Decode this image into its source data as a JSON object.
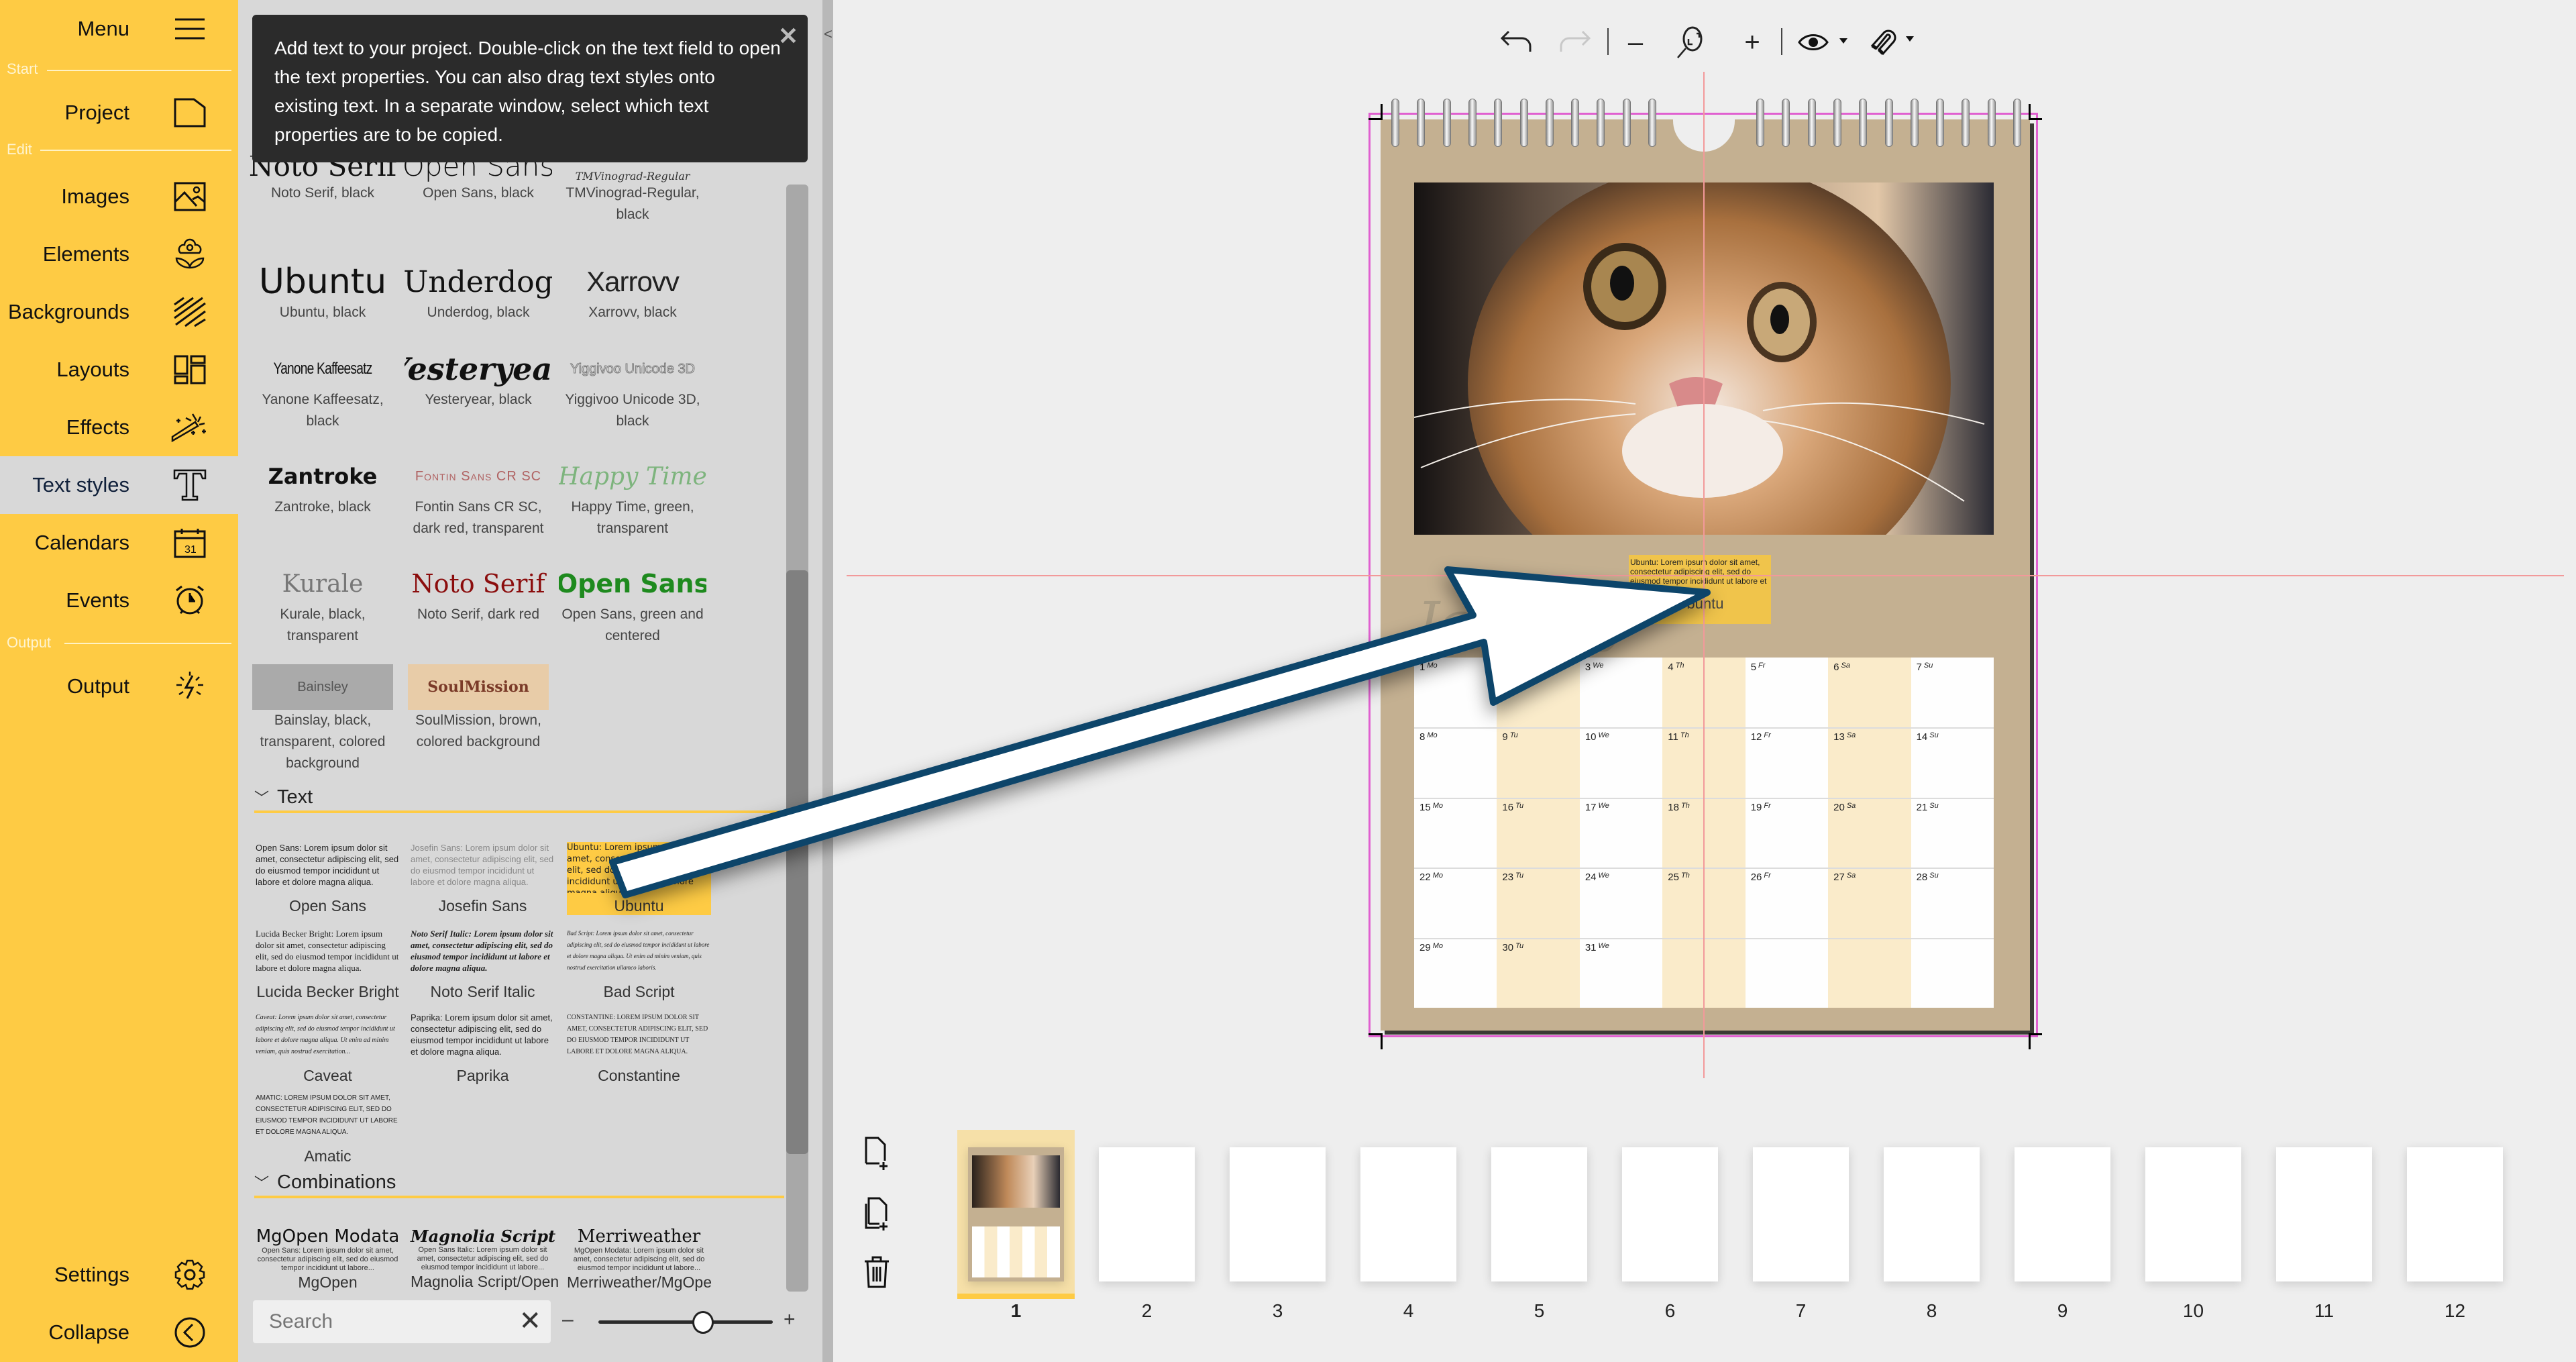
{
  "sidebar": {
    "menu_label": "Menu",
    "sections": {
      "start": "Start",
      "edit": "Edit",
      "output": "Output"
    },
    "items": [
      {
        "label": "Project",
        "icon": "page-icon"
      },
      {
        "label": "Images",
        "icon": "image-icon"
      },
      {
        "label": "Elements",
        "icon": "flower-icon"
      },
      {
        "label": "Backgrounds",
        "icon": "hatch-icon"
      },
      {
        "label": "Layouts",
        "icon": "layout-icon"
      },
      {
        "label": "Effects",
        "icon": "magic-wand-icon"
      },
      {
        "label": "Text styles",
        "icon": "text-icon",
        "active": true
      },
      {
        "label": "Calendars",
        "icon": "calendar-icon"
      },
      {
        "label": "Events",
        "icon": "alarm-clock-icon"
      },
      {
        "label": "Output",
        "icon": "output-icon"
      }
    ],
    "settings_label": "Settings",
    "collapse_label": "Collapse"
  },
  "panel": {
    "tooltip": "Add text to your project. Double-click on the text field to open the text properties. You can also drag text styles onto existing text. In a separate window, select which text properties are to be copied.",
    "tooltip_close": "✕",
    "styles": [
      {
        "sample": "Noto Serif",
        "desc": "Noto Serif, black"
      },
      {
        "sample": "Open Sans",
        "desc": "Open Sans, black"
      },
      {
        "sample": "TMVinograd-Regular",
        "desc": "TMVinograd-Regular, black"
      },
      {
        "sample": "Ubuntu",
        "desc": "Ubuntu, black"
      },
      {
        "sample": "Underdog",
        "desc": "Underdog, black"
      },
      {
        "sample": "Xarrovv",
        "desc": "Xarrovv, black"
      },
      {
        "sample": "Yanone Kaffeesatz",
        "desc": "Yanone Kaffeesatz, black"
      },
      {
        "sample": "Yesteryear",
        "desc": "Yesteryear, black"
      },
      {
        "sample": "Yiggivoo Unicode 3D",
        "desc": "Yiggivoo Unicode 3D, black"
      },
      {
        "sample": "Zantroke",
        "desc": "Zantroke, black"
      },
      {
        "sample": "Fontin Sans CR SC",
        "desc": "Fontin Sans CR SC, dark red, transparent"
      },
      {
        "sample": "Happy Time",
        "desc": "Happy Time, green, transparent"
      },
      {
        "sample": "Kurale",
        "desc": "Kurale, black, transparent"
      },
      {
        "sample": "Noto Serif",
        "desc": "Noto Serif, dark red"
      },
      {
        "sample": "Open Sans",
        "desc": "Open Sans, green and centered"
      },
      {
        "sample": "Bainsley",
        "desc": "Bainslay, black, transparent, colored background"
      },
      {
        "sample": "SoulMission",
        "desc": "SoulMission, brown, colored background"
      }
    ],
    "text_section": "Text",
    "text_items": [
      {
        "lorem": "Open Sans: Lorem ipsum dolor sit amet, consectetur adipiscing elit, sed do eiusmod tempor incididunt ut labore et dolore magna aliqua.",
        "name": "Open Sans"
      },
      {
        "lorem": "Josefin Sans: Lorem ipsum dolor sit amet, consectetur adipiscing elit, sed do eiusmod tempor incididunt ut labore et dolore magna aliqua.",
        "name": "Josefin Sans"
      },
      {
        "lorem": "Ubuntu: Lorem ipsum dolor sit amet, consectetur adipiscing elit, sed do eiusmod tempor incididunt ut labore et dolore magna aliqua.",
        "name": "Ubuntu",
        "selected": true
      },
      {
        "lorem": "Lucida Becker Bright: Lorem ipsum dolor sit amet, consectetur adipiscing elit, sed do eiusmod tempor incididunt ut labore et dolore magna aliqua.",
        "name": "Lucida Becker Bright"
      },
      {
        "lorem": "Noto Serif Italic: Lorem ipsum dolor sit amet, consectetur adipiscing elit, sed do eiusmod tempor incididunt ut labore et dolore magna aliqua.",
        "name": "Noto Serif Italic"
      },
      {
        "lorem": "Bad Script: Lorem ipsum dolor sit amet, consectetur adipiscing elit, sed do eiusmod tempor incididunt ut labore et dolore magna aliqua. Ut enim ad minim veniam, quis nostrud exercitation ullamco laboris.",
        "name": "Bad Script"
      },
      {
        "lorem": "Caveat: Lorem ipsum dolor sit amet, consectetur adipiscing elit, sed do eiusmod tempor incididunt ut labore et dolore magna aliqua. Ut enim ad minim veniam, quis nostrud exercitation...",
        "name": "Caveat"
      },
      {
        "lorem": "Paprika: Lorem ipsum dolor sit amet, consectetur adipiscing elit, sed do eiusmod tempor incididunt ut labore et dolore magna aliqua.",
        "name": "Paprika"
      },
      {
        "lorem": "CONSTANTINE: LOREM IPSUM DOLOR SIT AMET, CONSECTETUR ADIPISCING ELIT, SED DO EIUSMOD TEMPOR INCIDIDUNT UT LABORE ET DOLORE MAGNA ALIQUA.",
        "name": "Constantine"
      },
      {
        "lorem": "AMATIC: LOREM IPSUM DOLOR SIT AMET, CONSECTETUR ADIPISCING ELIT, SED DO EIUSMOD TEMPOR INCIDIDUNT UT LABORE ET DOLORE MAGNA ALIQUA.",
        "name": "Amatic"
      }
    ],
    "combinations_section": "Combinations",
    "combinations": [
      {
        "title": "MgOpen Modata",
        "lorem": "Open Sans: Lorem ipsum dolor sit amet, consectetur adipiscing elit, sed do eiusmod tempor incididunt ut labore...",
        "name": "MgOpen"
      },
      {
        "title": "Magnolia Script",
        "lorem": "Open Sans Italic: Lorem ipsum dolor sit amet, consectetur adipiscing elit, sed do eiusmod tempor incididunt ut labore...",
        "name": "Magnolia Script/Open"
      },
      {
        "title": "Merriweather",
        "lorem": "MgOpen Modata: Lorem ipsum dolor sit amet, consectetur adipiscing elit, sed do eiusmod tempor incididunt ut labore...",
        "name": "Merriweather/MgOpe"
      }
    ],
    "search": {
      "placeholder": "Search",
      "value": "",
      "clear": "✕"
    },
    "zoom": {
      "minus": "–",
      "plus": "+",
      "value": 0.6
    }
  },
  "toolbar": {
    "undo": "undo-icon",
    "redo": "redo-icon",
    "zoom_out": "–",
    "zoom_fit": "zoom-fit-icon",
    "zoom_in": "+",
    "preview": "eye-icon",
    "snap": "magnet-icon"
  },
  "calendar": {
    "month": "January",
    "weekday_abbr": [
      "Mo",
      "Tu",
      "We",
      "Th",
      "Fr",
      "Sa",
      "Su"
    ],
    "start_offset": 0,
    "days_in_month": 31,
    "text_box": {
      "lorem": "Ubuntu: Lorem ipsum dolor sit amet, consectetur adipiscing elit, sed do eiusmod tempor incididunt ut labore et dolore magna aliqua.",
      "name": "Ubuntu"
    }
  },
  "pages": {
    "tools": [
      "add-page-icon",
      "duplicate-page-icon",
      "trash-icon"
    ],
    "items": [
      "1",
      "2",
      "3",
      "4",
      "5",
      "6",
      "7",
      "8",
      "9",
      "10",
      "11",
      "12"
    ],
    "selected": 1
  },
  "colors": {
    "accent": "#fecb44",
    "panel_bg": "#d8d8d8",
    "canvas_bg": "#eeeeee",
    "page_bg": "#c4b091",
    "highlight_col": "#faebca",
    "arrow_stroke": "#0f446b"
  }
}
